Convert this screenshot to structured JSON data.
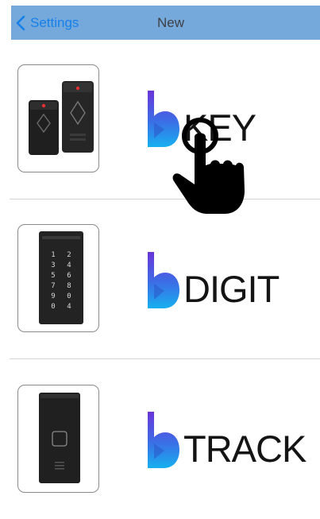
{
  "navbar": {
    "back_label": "Settings",
    "title": "New",
    "background_color": "#75a9dc",
    "link_color": "#1680e9",
    "back_icon": "chevron-left-icon"
  },
  "devices": [
    {
      "brand_letter": "b",
      "name": "KEY"
    },
    {
      "brand_letter": "b",
      "name": "DIGIT"
    },
    {
      "brand_letter": "b",
      "name": "TRACK"
    }
  ],
  "digit_keypad": {
    "keys": [
      "1",
      "2",
      "3",
      "4",
      "5",
      "6",
      "7",
      "8",
      "9",
      "0",
      "0",
      "4"
    ]
  },
  "overlay": {
    "icon": "pointing-hand-icon"
  }
}
